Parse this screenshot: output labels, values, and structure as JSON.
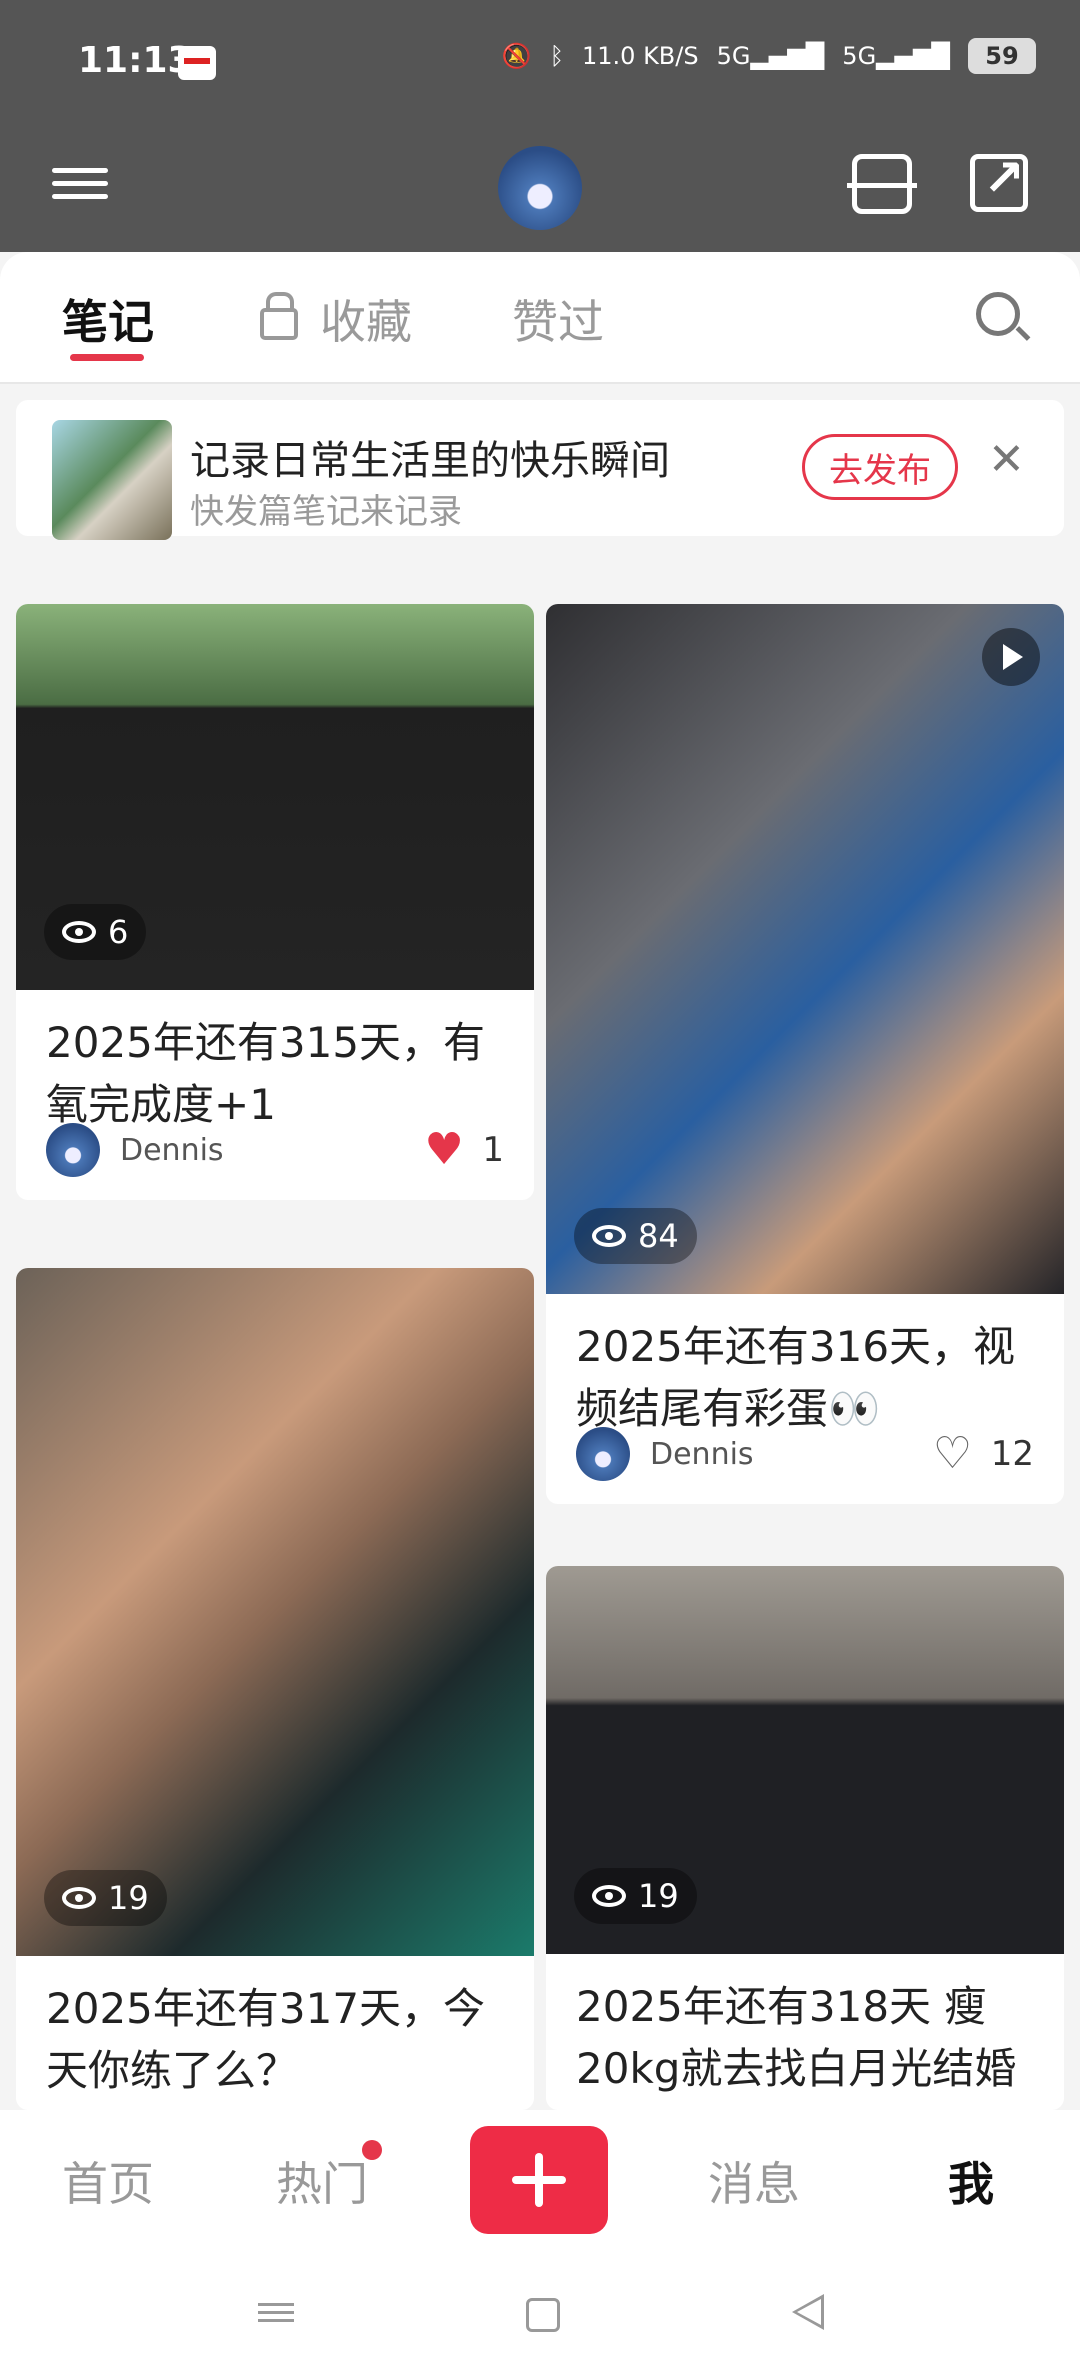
{
  "status": {
    "time": "11:13",
    "network_speed": "11.0",
    "network_unit": "KB/S",
    "battery": "59"
  },
  "tabs": [
    {
      "label": "笔记"
    },
    {
      "label": "收藏"
    },
    {
      "label": "赞过"
    }
  ],
  "promo": {
    "title": "记录日常生活里的快乐瞬间",
    "subtitle": "快发篇笔记来记录",
    "button": "去发布"
  },
  "cards": [
    {
      "views": "6",
      "title": "2025年还有315天，有氧完成度+1",
      "author": "Dennis",
      "likes": "1"
    },
    {
      "views": "84",
      "title": "2025年还有316天，视频结尾有彩蛋👀",
      "author": "Dennis",
      "likes": "12"
    },
    {
      "views": "19",
      "title": "2025年还有317天，今天你练了么？"
    },
    {
      "views": "19",
      "title": "2025年还有318天 瘦20kg就去找白月光结婚"
    }
  ],
  "bottom_nav": {
    "home": "首页",
    "hot": "热门",
    "messages": "消息",
    "me": "我"
  },
  "colors": {
    "accent": "#e5364a",
    "topbar": "#555555"
  }
}
